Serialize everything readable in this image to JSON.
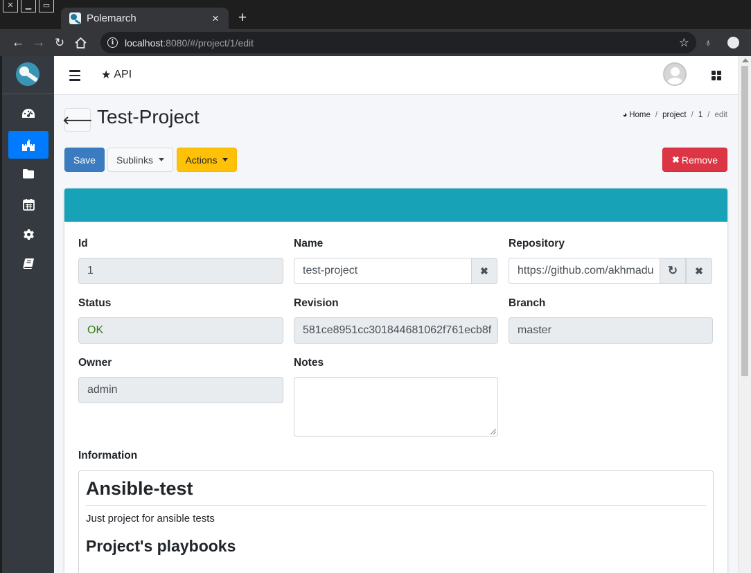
{
  "browser": {
    "tab_title": "Polemarch",
    "url_host": "localhost",
    "url_rest": ":8080/#/project/1/edit"
  },
  "navbar": {
    "api_label": "API"
  },
  "page": {
    "title": "Test-Project",
    "breadcrumb": {
      "home": "Home",
      "sep": "/",
      "project": "project",
      "id": "1",
      "current": "edit"
    }
  },
  "buttons": {
    "save": "Save",
    "sublinks": "Sublinks",
    "actions": "Actions",
    "remove": "Remove"
  },
  "form": {
    "id": {
      "label": "Id",
      "value": "1"
    },
    "name": {
      "label": "Name",
      "value": "test-project"
    },
    "repository": {
      "label": "Repository",
      "value": "https://github.com/akhmadu"
    },
    "status": {
      "label": "Status",
      "value": "OK"
    },
    "revision": {
      "label": "Revision",
      "value": "581ce8951cc301844681062f761ecb8f"
    },
    "branch": {
      "label": "Branch",
      "value": "master"
    },
    "owner": {
      "label": "Owner",
      "value": "admin"
    },
    "notes": {
      "label": "Notes",
      "value": ""
    },
    "information": {
      "label": "Information",
      "heading": "Ansible-test",
      "paragraph": "Just project for ansible tests",
      "subheading": "Project's playbooks"
    }
  },
  "colors": {
    "card_header": "#17a2b8",
    "save": "#3b7bbf",
    "actions": "#ffc107",
    "remove": "#dc3545",
    "sidebar": "#343a40",
    "sidebar_active": "#007bff",
    "status_ok": "#2e7d12"
  },
  "icons": {
    "sidebar": [
      "dashboard-icon",
      "projects-icon",
      "folder-icon",
      "calendar-icon",
      "settings-icon",
      "book-icon"
    ]
  }
}
